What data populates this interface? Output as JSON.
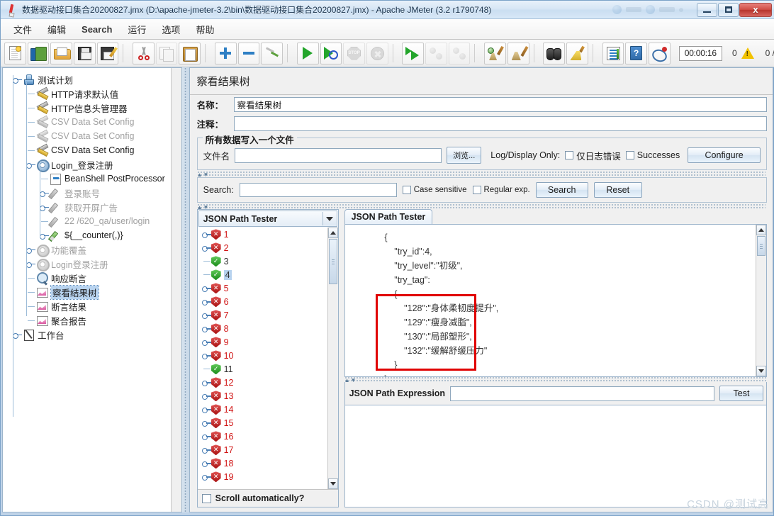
{
  "window": {
    "title": "数据驱动接口集合20200827.jmx (D:\\apache-jmeter-3.2\\bin\\数据驱动接口集合20200827.jmx) - Apache JMeter (3.2 r1790748)",
    "minimize_label": "",
    "maximize_label": "",
    "close_label": "x"
  },
  "menubar": {
    "items": [
      {
        "label": "文件",
        "lang": "zh"
      },
      {
        "label": "编辑",
        "lang": "zh"
      },
      {
        "label": "Search",
        "lang": "en"
      },
      {
        "label": "运行",
        "lang": "zh"
      },
      {
        "label": "选项",
        "lang": "zh"
      },
      {
        "label": "帮助",
        "lang": "zh"
      }
    ]
  },
  "toolbar": {
    "buttons": [
      {
        "name": "new-icon",
        "disabled": false
      },
      {
        "name": "templates-icon",
        "disabled": false
      },
      {
        "name": "open-icon",
        "disabled": false
      },
      {
        "name": "save-icon",
        "disabled": false
      },
      {
        "name": "save-as-icon",
        "disabled": false
      },
      {
        "name": "cut-icon",
        "disabled": false
      },
      {
        "name": "copy-icon",
        "disabled": true
      },
      {
        "name": "paste-icon",
        "disabled": false
      },
      {
        "name": "expand-icon",
        "disabled": false
      },
      {
        "name": "collapse-icon",
        "disabled": false
      },
      {
        "name": "toggle-icon",
        "disabled": false
      },
      {
        "name": "start-icon",
        "disabled": false
      },
      {
        "name": "start-no-pause-icon",
        "disabled": false
      },
      {
        "name": "stop-icon",
        "disabled": true
      },
      {
        "name": "shutdown-icon",
        "disabled": true
      },
      {
        "name": "remote-start-all-icon",
        "disabled": false
      },
      {
        "name": "remote-stop-all-icon",
        "disabled": true
      },
      {
        "name": "remote-shutdown-all-icon",
        "disabled": true
      },
      {
        "name": "clear-icon",
        "disabled": false
      },
      {
        "name": "clear-all-icon",
        "disabled": false
      },
      {
        "name": "search-icon",
        "disabled": false
      },
      {
        "name": "search-reset-icon",
        "disabled": false
      },
      {
        "name": "function-helper-icon",
        "disabled": false
      },
      {
        "name": "help-icon",
        "disabled": false
      },
      {
        "name": "undo-redo-icon",
        "disabled": false
      }
    ],
    "timer": "00:00:16",
    "warning_count": "0",
    "thread_counts": "0 /"
  },
  "tree": {
    "nodes": [
      {
        "label": "测试计划",
        "icon": "test-plan-icon",
        "indent": 0,
        "handle": "knob",
        "dim": false,
        "selected": false
      },
      {
        "label": "HTTP请求默认值",
        "icon": "config-wrench-icon",
        "indent": 1,
        "handle": "line",
        "dim": false,
        "selected": false
      },
      {
        "label": "HTTP信息头管理器",
        "icon": "config-wrench-icon",
        "indent": 1,
        "handle": "line",
        "dim": false,
        "selected": false
      },
      {
        "label": "CSV Data Set Config",
        "icon": "config-wrench-icon",
        "indent": 1,
        "handle": "line",
        "dim": true,
        "selected": false
      },
      {
        "label": "CSV Data Set Config",
        "icon": "config-wrench-icon",
        "indent": 1,
        "handle": "line",
        "dim": true,
        "selected": false
      },
      {
        "label": "CSV Data Set Config",
        "icon": "config-wrench-icon",
        "indent": 1,
        "handle": "line",
        "dim": false,
        "selected": false
      },
      {
        "label": "Login_登录注册",
        "icon": "thread-group-icon",
        "indent": 1,
        "handle": "knob",
        "dim": false,
        "selected": false
      },
      {
        "label": "BeanShell PostProcessor",
        "icon": "post-processor-icon",
        "indent": 2,
        "handle": "line",
        "dim": false,
        "selected": false
      },
      {
        "label": "登录账号",
        "icon": "sampler-icon",
        "indent": 2,
        "handle": "knob",
        "dim": true,
        "selected": false
      },
      {
        "label": "获取开屏广告",
        "icon": "sampler-icon",
        "indent": 2,
        "handle": "knob",
        "dim": true,
        "selected": false
      },
      {
        "label": "22 /620_qa/user/login",
        "icon": "sampler-icon",
        "indent": 2,
        "handle": "line",
        "dim": true,
        "selected": false
      },
      {
        "label": "${__counter(,)}",
        "icon": "sampler-green-icon",
        "indent": 2,
        "handle": "knob",
        "dim": false,
        "selected": false
      },
      {
        "label": "功能覆盖",
        "icon": "thread-group-icon",
        "indent": 1,
        "handle": "knob",
        "dim": true,
        "selected": false
      },
      {
        "label": "Login登录注册",
        "icon": "thread-group-icon",
        "indent": 1,
        "handle": "knob",
        "dim": true,
        "selected": false
      },
      {
        "label": "响应断言",
        "icon": "assertion-icon",
        "indent": 1,
        "handle": "line",
        "dim": false,
        "selected": false
      },
      {
        "label": "察看结果树",
        "icon": "listener-icon",
        "indent": 1,
        "handle": "line",
        "dim": false,
        "selected": true
      },
      {
        "label": "断言结果",
        "icon": "listener-icon",
        "indent": 1,
        "handle": "line",
        "dim": false,
        "selected": false
      },
      {
        "label": "聚合报告",
        "icon": "listener-icon",
        "indent": 1,
        "handle": "line",
        "dim": false,
        "selected": false
      },
      {
        "label": "工作台",
        "icon": "workbench-icon",
        "indent": 0,
        "handle": "knob",
        "dim": false,
        "selected": false
      }
    ]
  },
  "panel": {
    "title": "察看结果树",
    "name_label": "名称：",
    "name_value": "察看结果树",
    "comment_label": "注释：",
    "comment_value": "",
    "file_group_legend": "所有数据写入一个文件",
    "filename_label": "文件名",
    "filename_value": "",
    "browse_button": "浏览...",
    "log_display_only_label": "Log/Display Only:",
    "errors_only_label": "仅日志错误",
    "successes_label": "Successes",
    "configure_button": "Configure",
    "search_label": "Search:",
    "search_value": "",
    "case_sensitive_label": "Case sensitive",
    "regular_exp_label": "Regular exp.",
    "search_button": "Search",
    "reset_button": "Reset"
  },
  "results": {
    "view_selector": "JSON Path Tester",
    "scroll_automatically_label": "Scroll automatically?",
    "items": [
      {
        "label": "1",
        "status": "fail"
      },
      {
        "label": "2",
        "status": "fail"
      },
      {
        "label": "3",
        "status": "pass"
      },
      {
        "label": "4",
        "status": "pass",
        "selected": true
      },
      {
        "label": "5",
        "status": "fail"
      },
      {
        "label": "6",
        "status": "fail"
      },
      {
        "label": "7",
        "status": "fail"
      },
      {
        "label": "8",
        "status": "fail"
      },
      {
        "label": "9",
        "status": "fail"
      },
      {
        "label": "10",
        "status": "fail"
      },
      {
        "label": "11",
        "status": "pass"
      },
      {
        "label": "12",
        "status": "fail"
      },
      {
        "label": "13",
        "status": "fail"
      },
      {
        "label": "14",
        "status": "fail"
      },
      {
        "label": "15",
        "status": "fail"
      },
      {
        "label": "16",
        "status": "fail"
      },
      {
        "label": "17",
        "status": "fail"
      },
      {
        "label": "18",
        "status": "fail"
      },
      {
        "label": "19",
        "status": "fail"
      }
    ]
  },
  "viewer": {
    "tab_label": "JSON Path Tester",
    "json_content": "        {\n            \"try_id\":4,\n            \"try_level\":\"初级\",\n            \"try_tag\":\n            {\n                \"128\":\"身体柔韧度提升\",\n                \"129\":\"瘦身减脂\",\n                \"130\":\"局部塑形\",\n                \"132\":\"缓解舒缓压力\"\n            }\n        },",
    "expression_label": "JSON Path Expression",
    "expression_value": "",
    "test_button": "Test",
    "result_value": ""
  },
  "watermark": "CSDN @测试高",
  "colors": {
    "accent": "#2e7fc4",
    "fail": "#d01414",
    "pass": "#1b8c1b",
    "highlight_box": "#e00000",
    "selection": "#b8d3ef"
  }
}
